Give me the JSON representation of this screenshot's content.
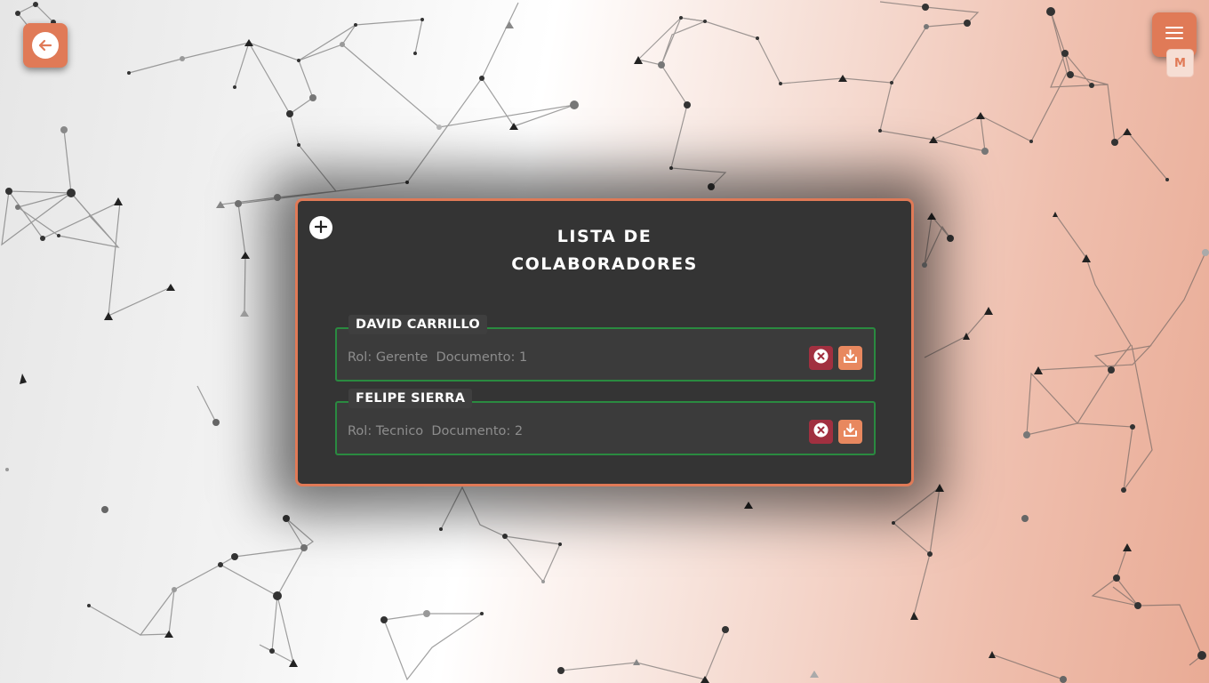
{
  "header": {
    "back_icon": "arrow-left-icon",
    "menu_icon": "hamburger-menu-icon",
    "user_badge": "M",
    "accent_color": "#e07a57"
  },
  "modal": {
    "add_icon": "plus-icon",
    "title_line1": "LISTA DE",
    "title_line2": "COLABORADORES",
    "collaborators": [
      {
        "name": "DAVID CARRILLO",
        "info": "Rol: Gerente  Documento: 1",
        "delete_icon": "close-circle-icon",
        "download_icon": "download-icon"
      },
      {
        "name": "FELIPE SIERRA",
        "info": "Rol: Tecnico  Documento: 2",
        "delete_icon": "close-circle-icon",
        "download_icon": "download-icon"
      }
    ]
  },
  "colors": {
    "card_border": "#2a8a40",
    "delete": "#a13040",
    "download": "#e8885f",
    "panel": "#343434"
  }
}
